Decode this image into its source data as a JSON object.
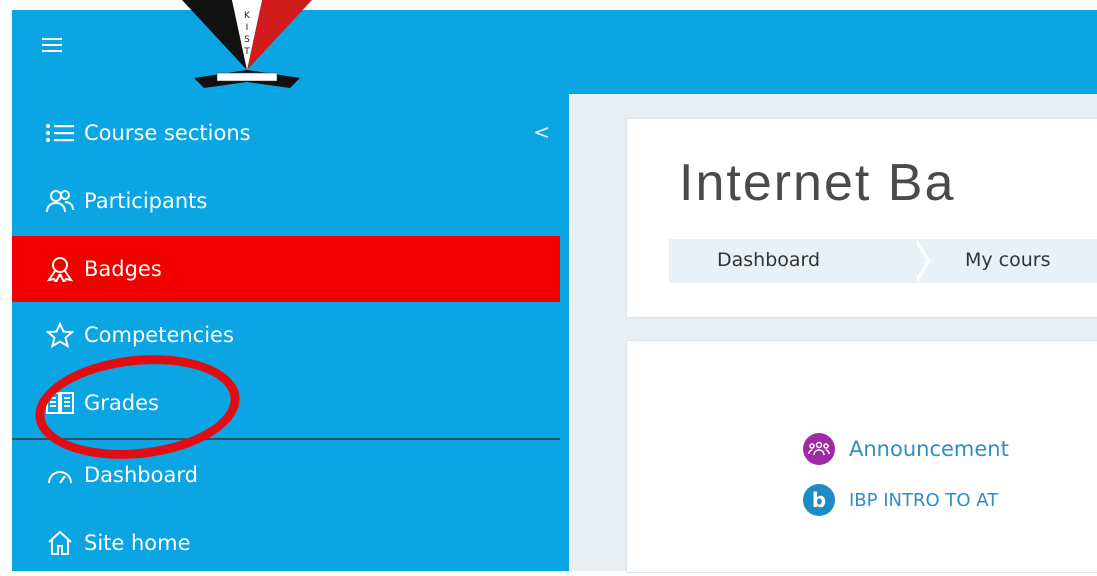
{
  "colors": {
    "brand": "#0ba5e3",
    "active": "#f20000",
    "annotation": "#e20d13"
  },
  "navbar": {
    "menu_icon": "hamburger-icon",
    "logo_letters": "KIST"
  },
  "sidebar": {
    "items": [
      {
        "label": "Course sections",
        "icon": "list-icon",
        "collapse_symbol": "<"
      },
      {
        "label": "Participants",
        "icon": "users-icon"
      },
      {
        "label": "Badges",
        "icon": "badge-icon",
        "active": true
      },
      {
        "label": "Competencies",
        "icon": "star-icon"
      },
      {
        "label": "Grades",
        "icon": "book-icon",
        "annotated": true
      },
      {
        "label": "Dashboard",
        "icon": "dashboard-icon"
      },
      {
        "label": "Site home",
        "icon": "home-icon"
      }
    ]
  },
  "main": {
    "page_title": "Internet Ba",
    "breadcrumb": [
      "Dashboard",
      "My cours"
    ],
    "activities": [
      {
        "label": "Announcement",
        "icon": "forum-icon",
        "color": "#a02aa3"
      },
      {
        "label": "IBP INTRO TO AT",
        "icon": "bigbluebutton-icon",
        "color": "#1d8bc4"
      }
    ]
  }
}
